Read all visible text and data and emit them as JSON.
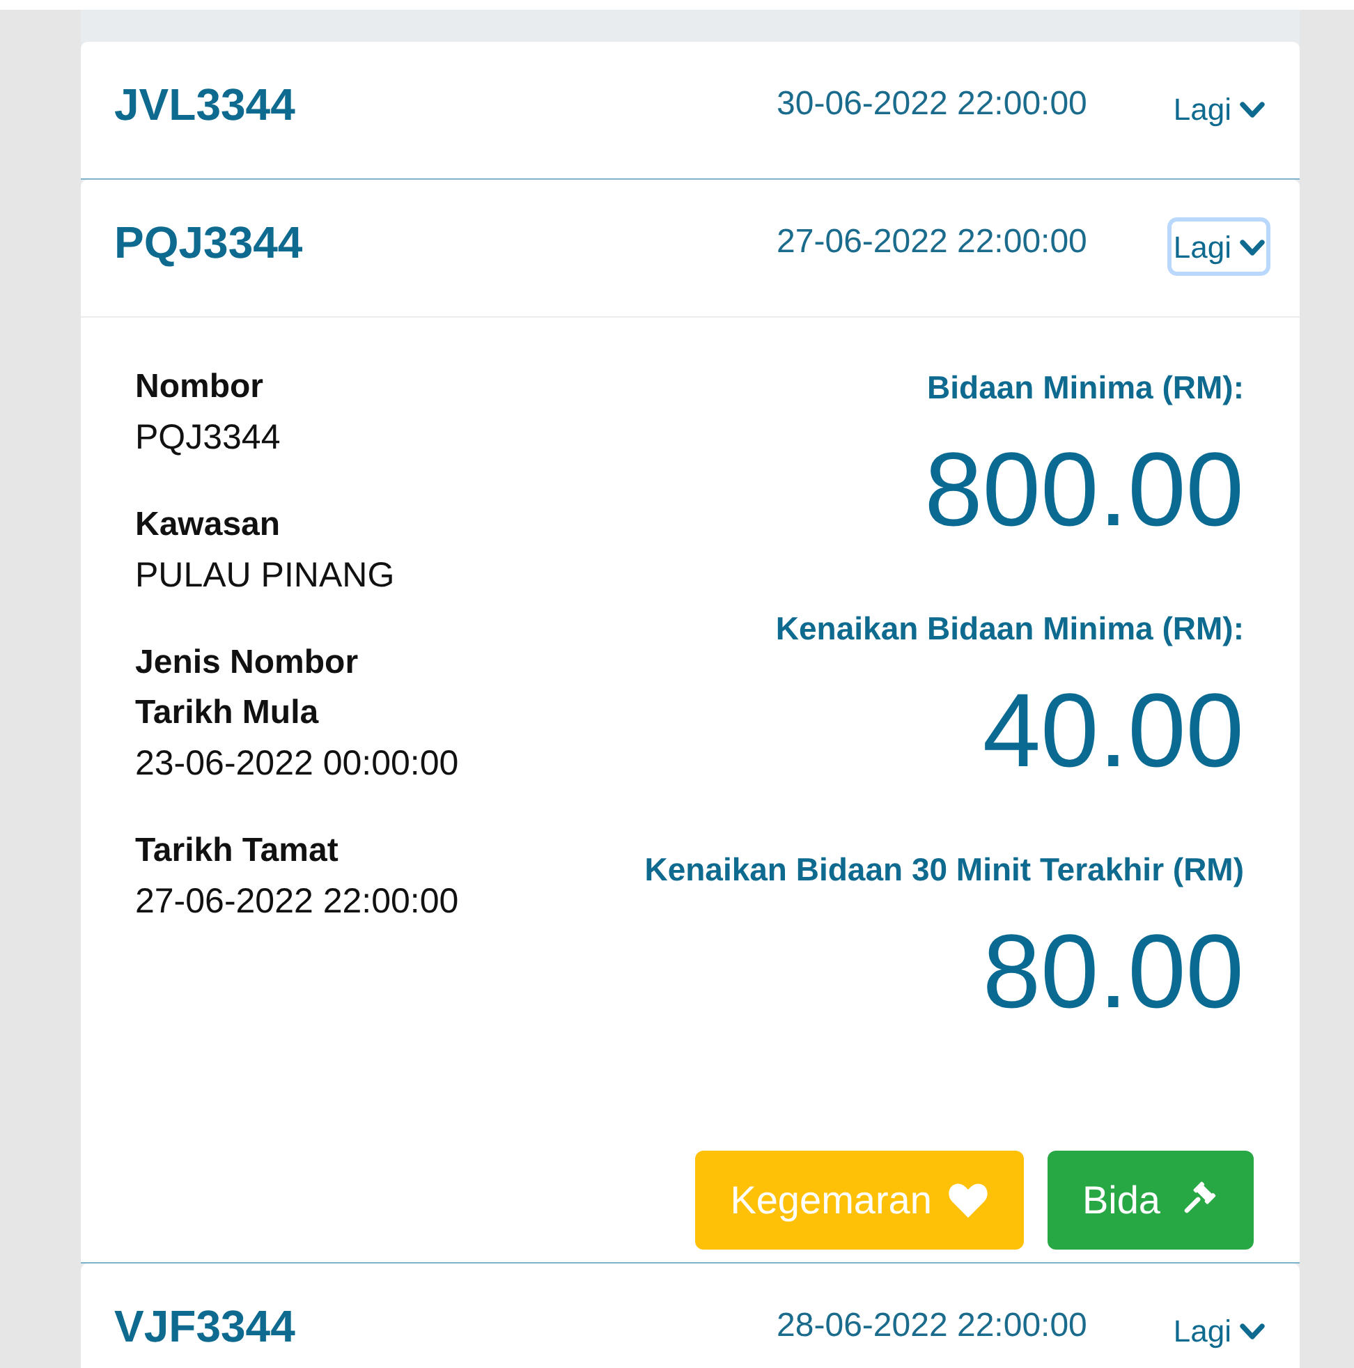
{
  "listings": [
    {
      "plate": "JVL3344",
      "end_time": "30-06-2022 22:00:00",
      "more_button": {
        "label": "Lagi",
        "focused": false
      }
    },
    {
      "plate": "PQJ3344",
      "end_time": "27-06-2022 22:00:00",
      "more_button": {
        "label": "Lagi",
        "focused": true
      },
      "details": {
        "fields": [
          {
            "label": "Nombor",
            "value": "PQJ3344"
          },
          {
            "label": "Kawasan",
            "value": "PULAU PINANG"
          },
          {
            "label": "Jenis Nombor"
          },
          {
            "label": "Tarikh Mula",
            "value": "23-06-2022 00:00:00"
          },
          {
            "label": "Tarikh Tamat",
            "value": "27-06-2022 22:00:00"
          }
        ],
        "amounts": [
          {
            "label": "Bidaan Minima (RM):",
            "value": "800.00"
          },
          {
            "label": "Kenaikan Bidaan Minima (RM):",
            "value": "40.00"
          },
          {
            "label": "Kenaikan Bidaan 30 Minit Terakhir (RM)",
            "value": "80.00"
          }
        ],
        "buttons": [
          {
            "kind": "favourite",
            "label": "Kegemaran"
          },
          {
            "kind": "bid",
            "label": "Bida"
          }
        ]
      }
    },
    {
      "plate": "VJF3344",
      "end_time": "28-06-2022 22:00:00",
      "more_button": {
        "label": "Lagi",
        "focused": false
      }
    }
  ]
}
